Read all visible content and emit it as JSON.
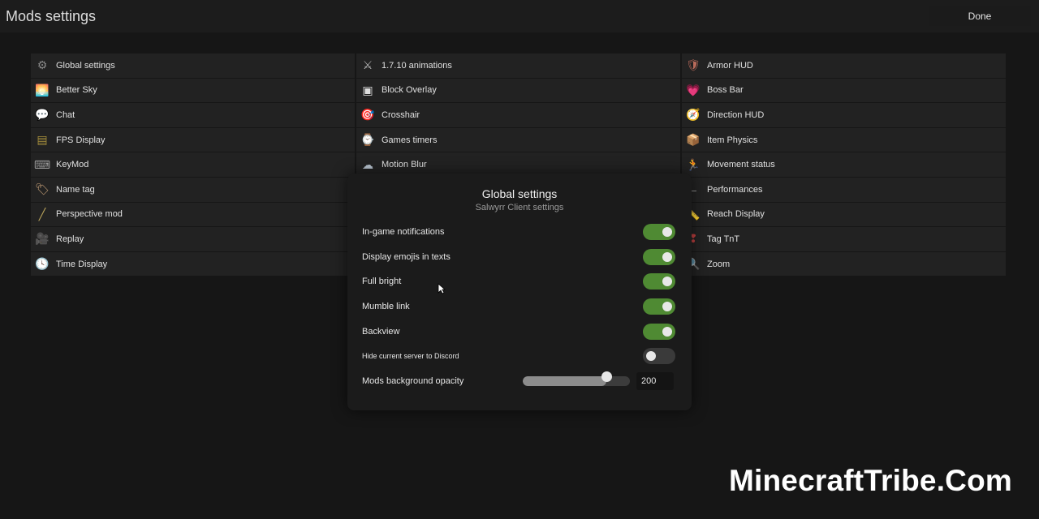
{
  "header": {
    "title": "Mods settings",
    "done_label": "Done"
  },
  "mods": {
    "columns": [
      [
        {
          "label": "Global settings",
          "icon": "gear-icon",
          "glyph": "⚙",
          "color": "#8a8a8a"
        },
        {
          "label": "Better Sky",
          "icon": "sunset-sky-icon",
          "glyph": "🌅",
          "color": "#c77a2a"
        },
        {
          "label": "Chat",
          "icon": "speech-bubble-icon",
          "glyph": "💬",
          "color": "#cfcfcf"
        },
        {
          "label": "FPS Display",
          "icon": "display-panel-icon",
          "glyph": "▤",
          "color": "#a8903c"
        },
        {
          "label": "KeyMod",
          "icon": "keyboard-icon",
          "glyph": "⌨",
          "color": "#9a9a9a"
        },
        {
          "label": "Name tag",
          "icon": "name-tag-icon",
          "glyph": "🏷",
          "color": "#c9a27a"
        },
        {
          "label": "Perspective mod",
          "icon": "camera-pole-icon",
          "glyph": "╱",
          "color": "#b8a25a"
        },
        {
          "label": "Replay",
          "icon": "film-camera-icon",
          "glyph": "🎥",
          "color": "#8c8c8c"
        },
        {
          "label": "Time Display",
          "icon": "clock-icon",
          "glyph": "🕓",
          "color": "#bdbdbd"
        }
      ],
      [
        {
          "label": "1.7.10 animations",
          "icon": "crossed-swords-icon",
          "glyph": "⚔",
          "color": "#b8b8b8"
        },
        {
          "label": "Block Overlay",
          "icon": "block-outline-icon",
          "glyph": "▣",
          "color": "#dddddd"
        },
        {
          "label": "Crosshair",
          "icon": "target-icon",
          "glyph": "🎯",
          "color": "#c0463c"
        },
        {
          "label": "Games timers",
          "icon": "stopwatch-icon",
          "glyph": "⌚",
          "color": "#9a9a9a"
        },
        {
          "label": "Motion Blur",
          "icon": "blur-cloud-icon",
          "glyph": "☁",
          "color": "#b8c4d0"
        }
      ],
      [
        {
          "label": "Armor HUD",
          "icon": "shield-icon",
          "glyph": "🛡",
          "color": "#b86a5a"
        },
        {
          "label": "Boss Bar",
          "icon": "heart-icon",
          "glyph": "💗",
          "color": "#d0508a"
        },
        {
          "label": "Direction HUD",
          "icon": "compass-icon",
          "glyph": "🧭",
          "color": "#bdbdbd"
        },
        {
          "label": "Item Physics",
          "icon": "crate-icon",
          "glyph": "📦",
          "color": "#a87a44"
        },
        {
          "label": "Movement status",
          "icon": "running-figure-icon",
          "glyph": "🏃",
          "color": "#c87a5a"
        },
        {
          "label": "Performances",
          "icon": "dash-icon",
          "glyph": "–",
          "color": "#9a9a9a"
        },
        {
          "label": "Reach Display",
          "icon": "reach-arm-icon",
          "glyph": "📏",
          "color": "#9a9a9a"
        },
        {
          "label": "Tag TnT",
          "icon": "tnt-tag-icon",
          "glyph": "❢",
          "color": "#c04040"
        },
        {
          "label": "Zoom",
          "icon": "magnifier-icon",
          "glyph": "🔍",
          "color": "#bdbdbd"
        }
      ]
    ]
  },
  "panel": {
    "title": "Global settings",
    "subtitle": "Salwyrr Client settings",
    "settings": [
      {
        "label": "In-game notifications",
        "on": true
      },
      {
        "label": "Display emojis in texts",
        "on": true
      },
      {
        "label": "Full bright",
        "on": true
      },
      {
        "label": "Mumble link",
        "on": true
      },
      {
        "label": "Backview",
        "on": true
      },
      {
        "label": "Hide current server to Discord",
        "on": false
      }
    ],
    "slider": {
      "label": "Mods background opacity",
      "value": "200",
      "fraction": 0.78
    }
  },
  "colors": {
    "toggle_on": "#4f8a33",
    "toggle_off": "#3a3a3a",
    "background": "#161616"
  },
  "watermark": "MinecraftTribe.Com"
}
